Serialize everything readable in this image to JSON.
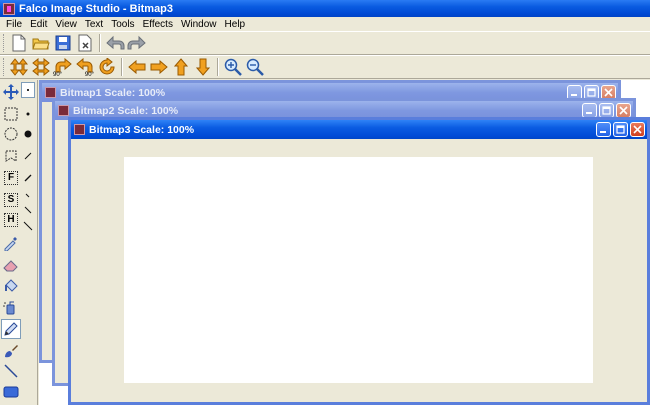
{
  "app": {
    "title": "Falco Image Studio - Bitmap3"
  },
  "menu": [
    "File",
    "Edit",
    "View",
    "Text",
    "Tools",
    "Effects",
    "Window",
    "Help"
  ],
  "toolbar1": {
    "buttons": [
      "new-file-icon",
      "open-folder-icon",
      "save-disk-icon",
      "close-document-icon",
      "undo-icon",
      "redo-icon"
    ]
  },
  "toolbar2": {
    "buttons": [
      "flip-vertical-icon",
      "flip-horizontal-icon",
      "rotate-right-90-icon",
      "rotate-left-90-icon",
      "rotate-free-icon",
      "move-left-icon",
      "move-right-icon",
      "move-up-icon",
      "move-down-icon",
      "zoom-in-icon",
      "zoom-out-icon"
    ],
    "rotate_right_label": "90°",
    "rotate_left_label": "90°"
  },
  "toolbox": {
    "tools": [
      "move-tool-icon",
      "rect-select-icon",
      "ellipse-select-icon",
      "lasso-select-icon",
      "text-f-icon",
      "text-s-icon",
      "text-h-icon",
      "eyedropper-icon",
      "eraser-icon",
      "paint-bucket-icon",
      "airbrush-icon",
      "pencil-icon",
      "brush-icon",
      "line-icon",
      "rectangle-shape-icon"
    ],
    "text_f": "F",
    "text_s": "S",
    "text_h": "H"
  },
  "windows": [
    {
      "title": "Bitmap1  Scale: 100%"
    },
    {
      "title": "Bitmap2  Scale: 100%"
    },
    {
      "title": "Bitmap3  Scale: 100%"
    }
  ],
  "colors": {
    "title_blue": "#0a5be0",
    "inactive_blue": "#7f98e0",
    "close_red": "#cf3f1f",
    "arrow_orange": "#f0a020"
  }
}
